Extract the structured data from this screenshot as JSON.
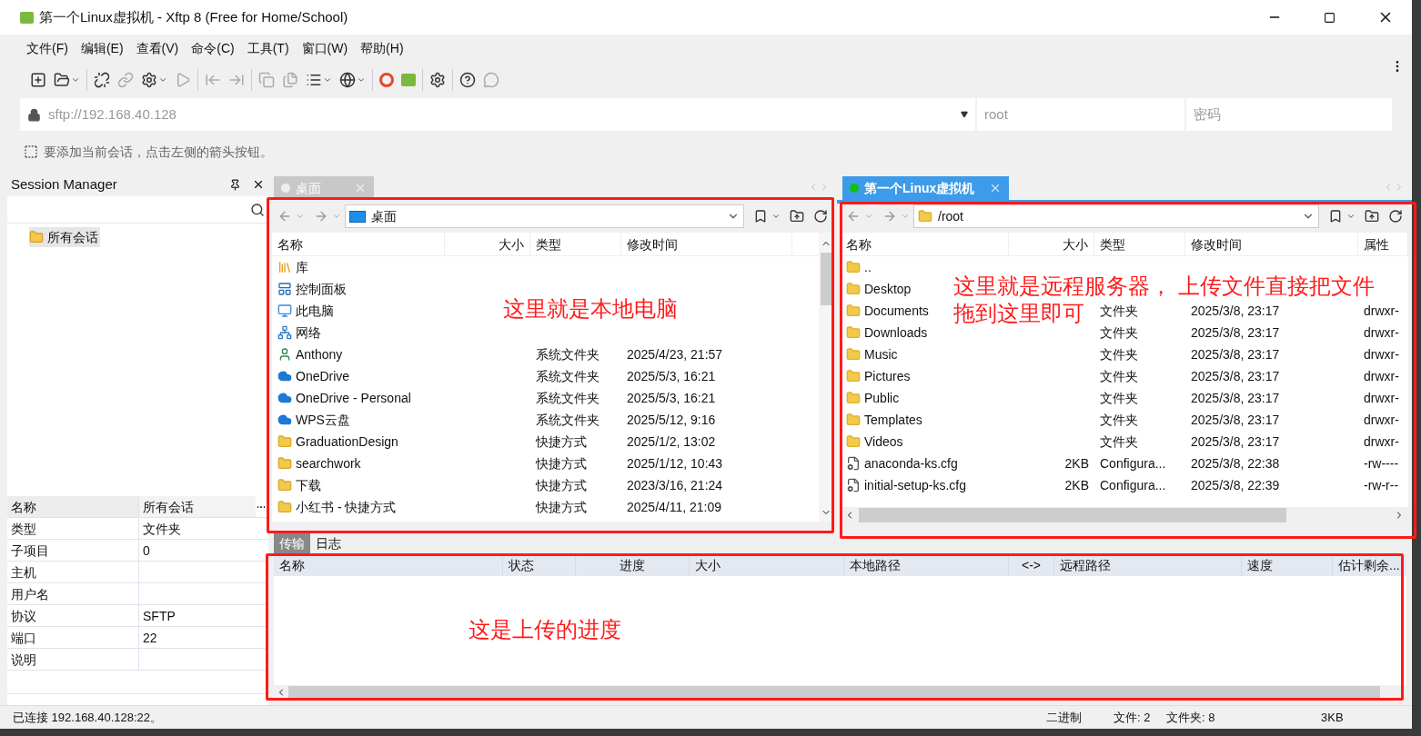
{
  "window": {
    "title": "第一个Linux虚拟机 - Xftp 8 (Free for Home/School)"
  },
  "menu": [
    "文件(F)",
    "编辑(E)",
    "查看(V)",
    "命令(C)",
    "工具(T)",
    "窗口(W)",
    "帮助(H)"
  ],
  "address_bar": {
    "url": "sftp://192.168.40.128",
    "username_placeholder": "root",
    "password_placeholder": "密码"
  },
  "hint": "要添加当前会话，点击左侧的箭头按钮。",
  "session_manager": {
    "title": "Session Manager",
    "tree": [
      {
        "label": "所有会话",
        "selected": true
      }
    ],
    "properties": [
      {
        "name": "名称",
        "value": "所有会话"
      },
      {
        "name": "类型",
        "value": "文件夹"
      },
      {
        "name": "子项目",
        "value": "0"
      },
      {
        "name": "主机"
      },
      {
        "name": "用户名"
      },
      {
        "name": "协议",
        "value": "SFTP"
      },
      {
        "name": "端口",
        "value": "22"
      },
      {
        "name": "说明"
      }
    ]
  },
  "local": {
    "tab": {
      "label": "桌面",
      "connected": false,
      "selected": false
    },
    "path": "桌面",
    "columns": [
      "名称",
      "大小",
      "类型",
      "修改时间"
    ],
    "rows": [
      {
        "kind": "library",
        "name": "库"
      },
      {
        "kind": "control-panel",
        "name": "控制面板"
      },
      {
        "kind": "computer",
        "name": "此电脑"
      },
      {
        "kind": "network",
        "name": "网络"
      },
      {
        "kind": "user-folder",
        "name": "Anthony",
        "type": "系统文件夹",
        "modified": "2025/4/23, 21:57"
      },
      {
        "kind": "cloud",
        "name": "OneDrive",
        "type": "系统文件夹",
        "modified": "2025/5/3, 16:21"
      },
      {
        "kind": "cloud",
        "name": "OneDrive - Personal",
        "type": "系统文件夹",
        "modified": "2025/5/3, 16:21"
      },
      {
        "kind": "cloud",
        "name": "WPS云盘",
        "type": "系统文件夹",
        "modified": "2025/5/12, 9:16"
      },
      {
        "kind": "shortcut",
        "name": "GraduationDesign",
        "type": "快捷方式",
        "modified": "2025/1/2, 13:02"
      },
      {
        "kind": "shortcut",
        "name": "searchwork",
        "type": "快捷方式",
        "modified": "2025/1/12, 10:43"
      },
      {
        "kind": "shortcut",
        "name": "下载",
        "type": "快捷方式",
        "modified": "2023/3/16, 21:24"
      },
      {
        "kind": "shortcut",
        "name": "小红书 - 快捷方式",
        "type": "快捷方式",
        "modified": "2025/4/11, 21:09"
      }
    ]
  },
  "remote": {
    "tab": {
      "label": "第一个Linux虚拟机",
      "connected": true,
      "selected": true
    },
    "path": "/root",
    "columns": [
      "名称",
      "大小",
      "类型",
      "修改时间",
      "属性"
    ],
    "rows": [
      {
        "kind": "folder",
        "name": ".."
      },
      {
        "kind": "folder",
        "name": "Desktop"
      },
      {
        "kind": "folder",
        "name": "Documents",
        "type": "文件夹",
        "modified": "2025/3/8, 23:17",
        "attributes": "drwxr-"
      },
      {
        "kind": "folder",
        "name": "Downloads",
        "type": "文件夹",
        "modified": "2025/3/8, 23:17",
        "attributes": "drwxr-"
      },
      {
        "kind": "folder",
        "name": "Music",
        "type": "文件夹",
        "modified": "2025/3/8, 23:17",
        "attributes": "drwxr-"
      },
      {
        "kind": "folder",
        "name": "Pictures",
        "type": "文件夹",
        "modified": "2025/3/8, 23:17",
        "attributes": "drwxr-"
      },
      {
        "kind": "folder",
        "name": "Public",
        "type": "文件夹",
        "modified": "2025/3/8, 23:17",
        "attributes": "drwxr-"
      },
      {
        "kind": "folder",
        "name": "Templates",
        "type": "文件夹",
        "modified": "2025/3/8, 23:17",
        "attributes": "drwxr-"
      },
      {
        "kind": "folder",
        "name": "Videos",
        "type": "文件夹",
        "modified": "2025/3/8, 23:17",
        "attributes": "drwxr-"
      },
      {
        "kind": "config",
        "name": "anaconda-ks.cfg",
        "size": "2KB",
        "type": "Configura...",
        "modified": "2025/3/8, 22:38",
        "attributes": "-rw----"
      },
      {
        "kind": "config",
        "name": "initial-setup-ks.cfg",
        "size": "2KB",
        "type": "Configura...",
        "modified": "2025/3/8, 22:39",
        "attributes": "-rw-r--"
      }
    ]
  },
  "transfer": {
    "tabs": [
      {
        "label": "传输",
        "selected": true
      },
      {
        "label": "日志",
        "selected": false
      }
    ],
    "columns": [
      "名称",
      "状态",
      "进度",
      "大小",
      "本地路径",
      "<->",
      "远程路径",
      "速度",
      "估计剩余..."
    ]
  },
  "status_bar": {
    "connection": "已连接 192.168.40.128:22。",
    "mode": "二进制",
    "files": "文件: 2",
    "folders": "文件夹: 8",
    "size": "3KB"
  },
  "annotations": [
    {
      "lines": [
        "这里就是本地电脑"
      ]
    },
    {
      "lines": [
        "这里就是远程服务器， 上传文件直接把文件",
        "拖到这里即可"
      ]
    },
    {
      "lines": [
        "这是上传的进度"
      ]
    }
  ]
}
